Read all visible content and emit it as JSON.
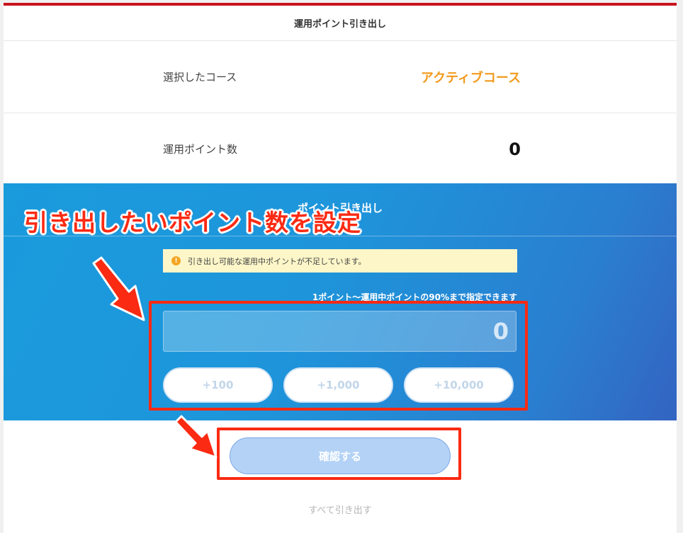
{
  "header": {
    "title": "運用ポイント引き出し"
  },
  "course_row": {
    "label": "選択したコース",
    "value": "アクティブコース"
  },
  "points_row": {
    "label": "運用ポイント数",
    "value": "0"
  },
  "withdraw_section": {
    "title": "ポイント引き出し",
    "warning": "引き出し可能な運用中ポイントが不足しています。",
    "hint": "1ポイント〜運用中ポイントの90%まで指定できます",
    "amount_value": "0",
    "add_buttons": [
      "+100",
      "+1,000",
      "+10,000"
    ]
  },
  "confirm_button": {
    "label": "確認する"
  },
  "withdraw_all_link": {
    "label": "すべて引き出す"
  },
  "annotation": {
    "title": "引き出したいポイント数を設定"
  },
  "colors": {
    "accent_red": "#c8131c",
    "course_orange": "#f29a1d",
    "annotation_red": "#fb2a12",
    "section_blue": "#1e95db"
  }
}
